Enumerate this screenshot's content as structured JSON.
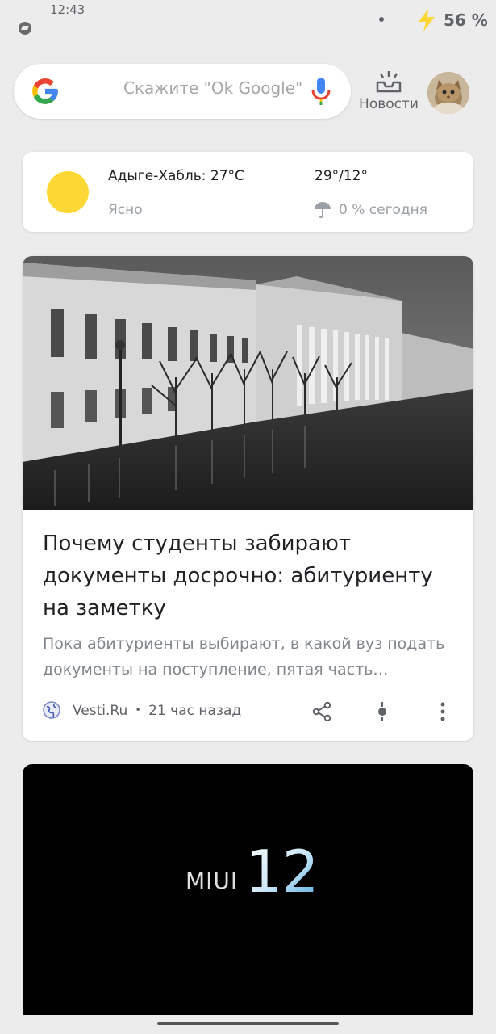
{
  "status_bar": {
    "time": "12:43",
    "battery": "56 %",
    "icons": [
      "telegram-icon",
      "dot-icon",
      "charging-bolt-icon"
    ]
  },
  "search": {
    "placeholder": "Скажите \"Ok Google\"",
    "news_label": "Новости",
    "icons": [
      "google-logo-icon",
      "microphone-icon",
      "news-inbox-icon",
      "avatar-cat"
    ]
  },
  "weather": {
    "location": "Адыге-Хабль: 27°C",
    "condition": "Ясно",
    "range": "29°/12°",
    "precip": "0 % сегодня",
    "icons": [
      "sun-icon",
      "umbrella-icon"
    ]
  },
  "news_card": {
    "title": "Почему студенты забирают документы досрочно: абитуриенту на заметку",
    "snippet": "Пока абитуриенты выбирают, в какой вуз подать документы на поступление, пятая часть документов будет забрана досрочно",
    "source": "Vesti.Ru",
    "separator": "•",
    "time": "21 час назад",
    "icons": [
      "globe-icon",
      "share-icon",
      "follow-icon",
      "more-vert-icon"
    ]
  },
  "video_card": {
    "brand": "MIUI",
    "version": "12"
  },
  "colors": {
    "background": "#ececec",
    "card": "#ffffff",
    "sun": "#fdd835",
    "google_blue": "#4285f4",
    "google_red": "#ea4335",
    "google_yellow": "#fbbc05",
    "google_green": "#34a853",
    "miui_accent": "#4aa8e0"
  }
}
